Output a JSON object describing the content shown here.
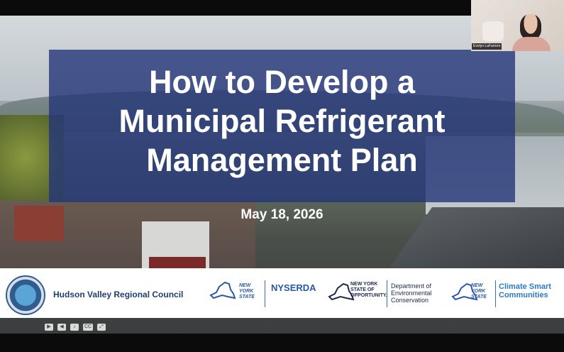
{
  "slide": {
    "title_lines": [
      "How to Develop a",
      "Municipal Refrigerant",
      "Management Plan"
    ],
    "date": "May 18, 2026"
  },
  "logos": {
    "hvrc_name": "Hudson Valley Regional Council",
    "nys_text_1": "NEW YORK STATE",
    "nyserda": "NYSERDA",
    "nys_text_2": "NEW YORK STATE OF OPPORTUNITY.",
    "dec_line1": "Department of",
    "dec_line2": "Environmental",
    "dec_line3": "Conservation",
    "nys_text_3": "NEW YORK STATE",
    "csc_line1": "Climate Smart",
    "csc_line2": "Communities"
  },
  "controls": {
    "cc_label": "CC"
  },
  "participant": {
    "name": "Evelyn LaFarrere"
  },
  "colors": {
    "banner": "#243678",
    "logo_blue": "#2a59a8"
  }
}
